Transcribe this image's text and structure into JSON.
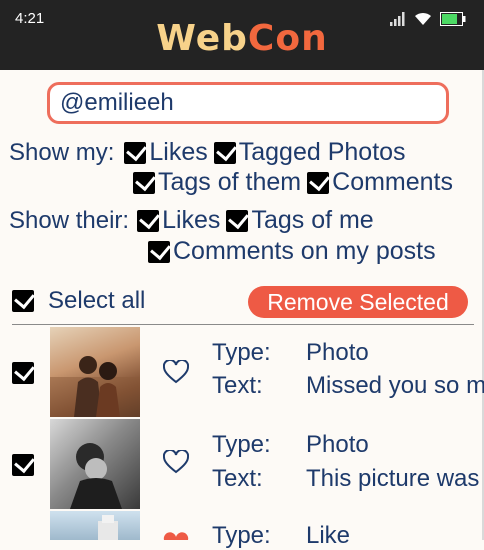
{
  "status": {
    "time": "4:21"
  },
  "logo": {
    "part1": "Web",
    "part2": "Con"
  },
  "search": {
    "value": "@emilieeh"
  },
  "filters": {
    "show_my_label": "Show my:",
    "show_my_options": [
      "Likes",
      "Tagged Photos",
      "Tags of them",
      "Comments"
    ],
    "show_their_label": "Show their:",
    "show_their_options": [
      "Likes",
      "Tags of me",
      "Comments on my posts"
    ]
  },
  "actions": {
    "select_all": "Select all",
    "remove_selected": "Remove Selected"
  },
  "items": [
    {
      "type_label": "Type:",
      "type": "Photo",
      "text_label": "Text:",
      "text": "Missed you so m",
      "heart": "outline",
      "checked": true
    },
    {
      "type_label": "Type:",
      "type": "Photo",
      "text_label": "Text:",
      "text": "This picture was",
      "heart": "outline",
      "checked": true
    },
    {
      "type_label": "Type:",
      "type": "Like",
      "text_label": "",
      "text": "",
      "heart": "filled",
      "checked": false
    }
  ],
  "colors": {
    "accent": "#ee5a45",
    "text": "#1e3a6b",
    "logo_web": "#f7d28a",
    "logo_con": "#f2683e"
  }
}
